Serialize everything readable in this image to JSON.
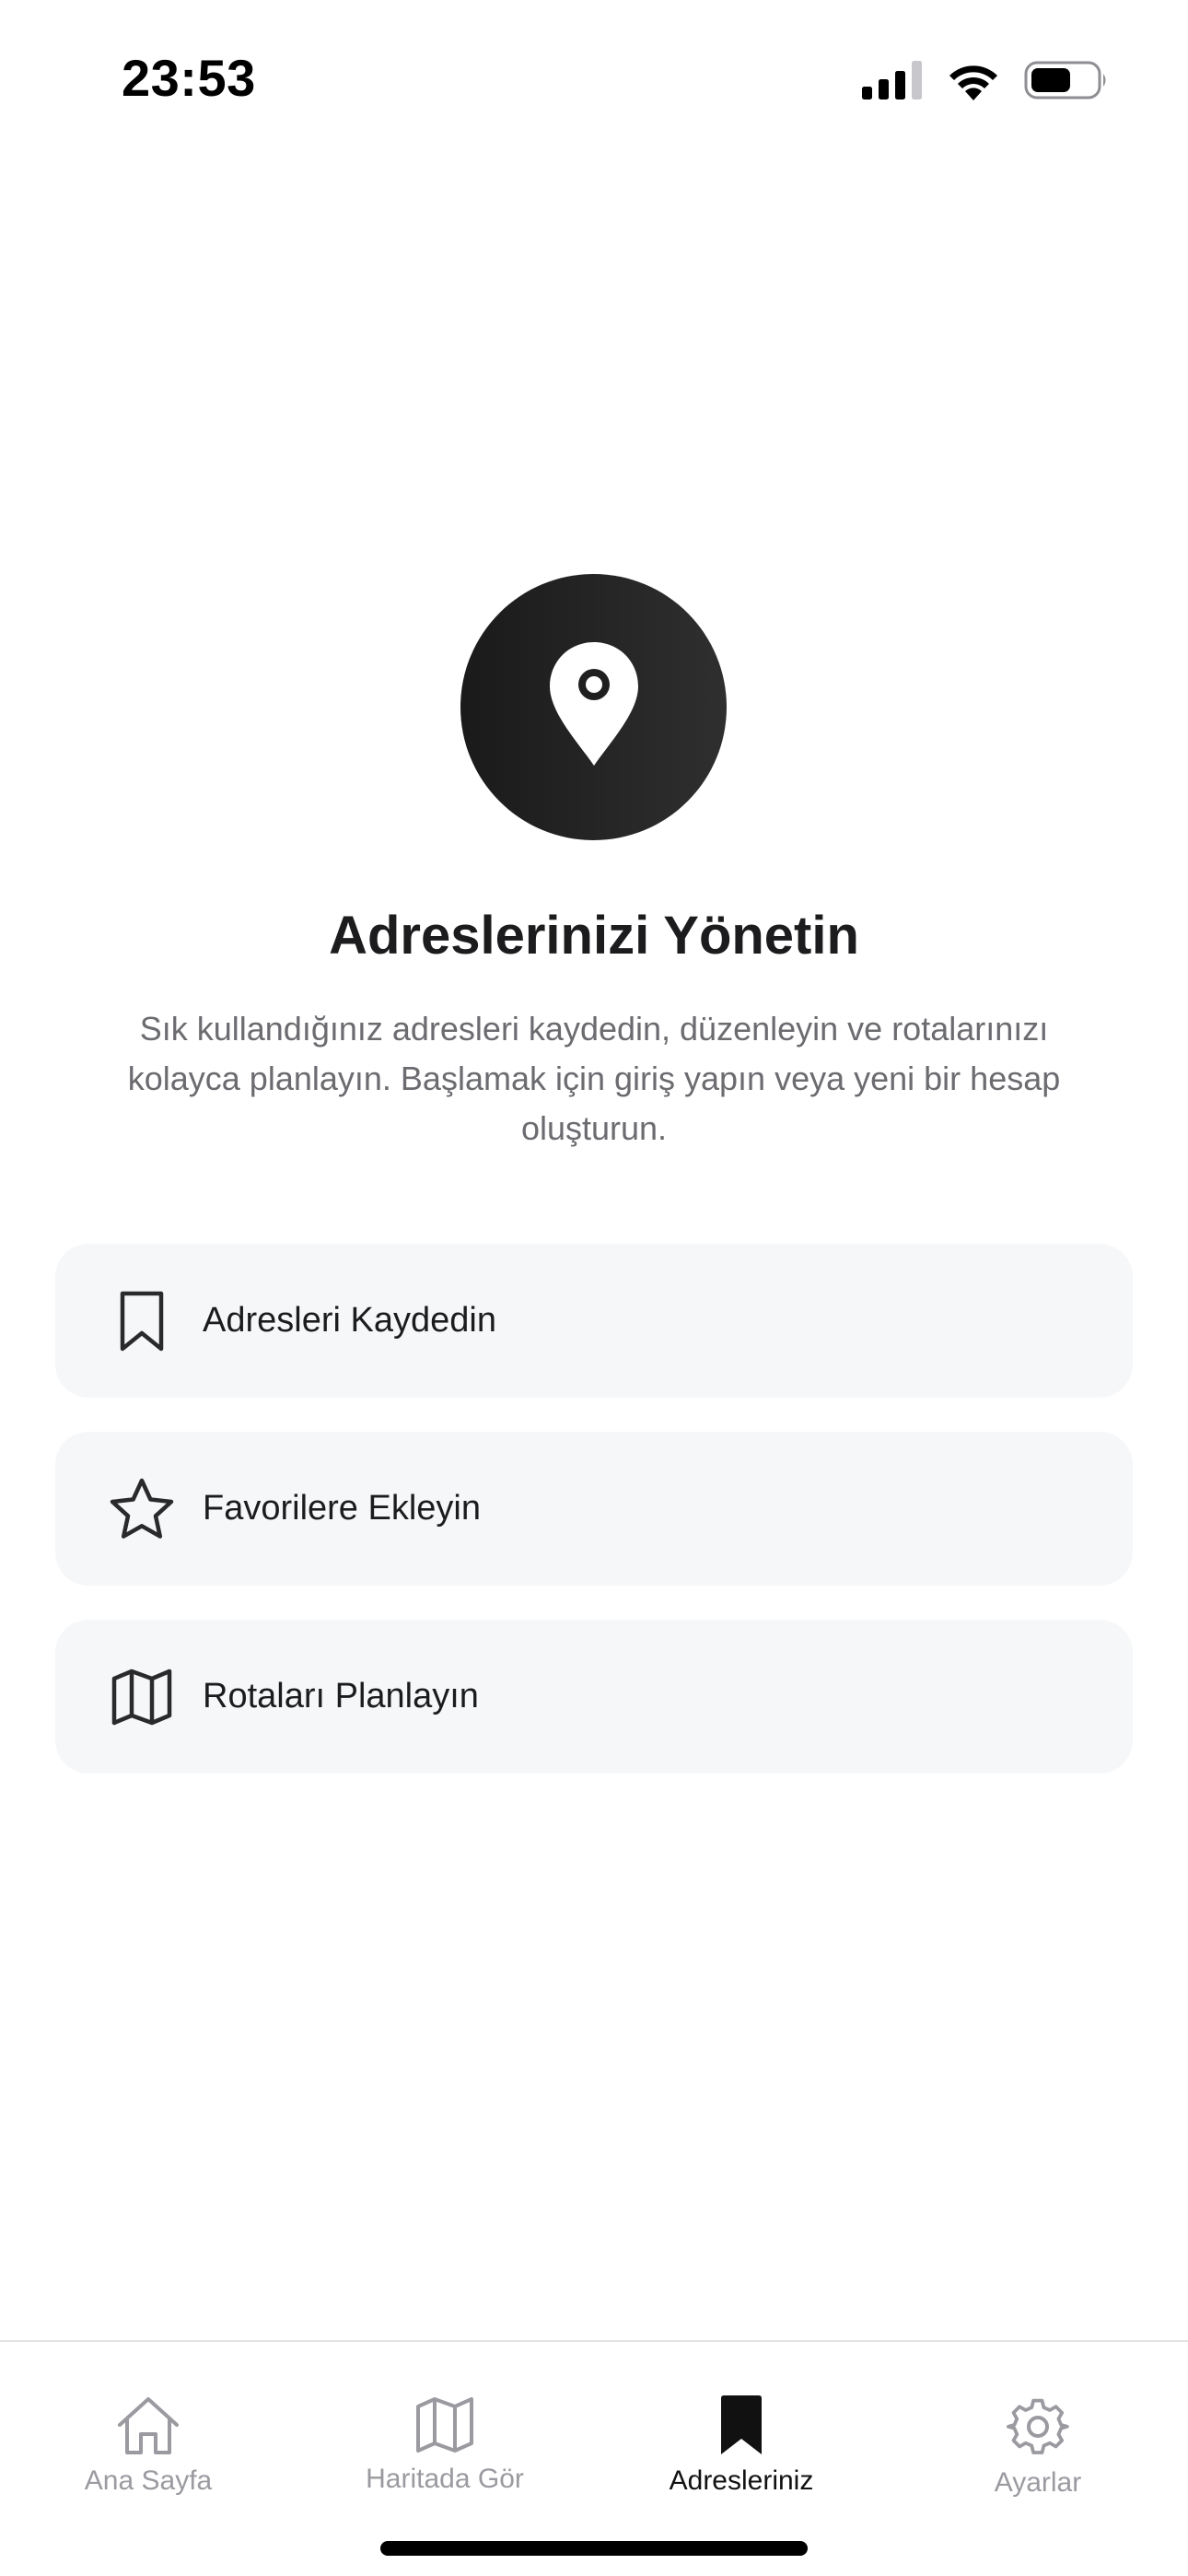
{
  "status_bar": {
    "time": "23:53"
  },
  "hero": {
    "icon": "map-pin-icon",
    "title": "Adreslerinizi Yönetin",
    "description": "Sık kullandığınız adresleri kaydedin, düzenleyin ve rotalarınızı kolayca planlayın. Başlamak için giriş yapın veya yeni bir hesap oluşturun."
  },
  "features": [
    {
      "icon": "bookmark-icon",
      "label": "Adresleri Kaydedin"
    },
    {
      "icon": "star-icon",
      "label": "Favorilere Ekleyin"
    },
    {
      "icon": "map-icon",
      "label": "Rotaları Planlayın"
    }
  ],
  "tab_bar": {
    "tabs": [
      {
        "icon": "home-icon",
        "label": "Ana Sayfa",
        "active": false
      },
      {
        "icon": "map-icon",
        "label": "Haritada Gör",
        "active": false
      },
      {
        "icon": "bookmark-filled-icon",
        "label": "Adresleriniz",
        "active": true
      },
      {
        "icon": "gear-icon",
        "label": "Ayarlar",
        "active": false
      }
    ]
  },
  "colors": {
    "accent": "#1c1c1e",
    "card_bg": "#f6f7f9",
    "muted_text": "#6b6b70",
    "inactive_tab": "#9a9aa0"
  }
}
